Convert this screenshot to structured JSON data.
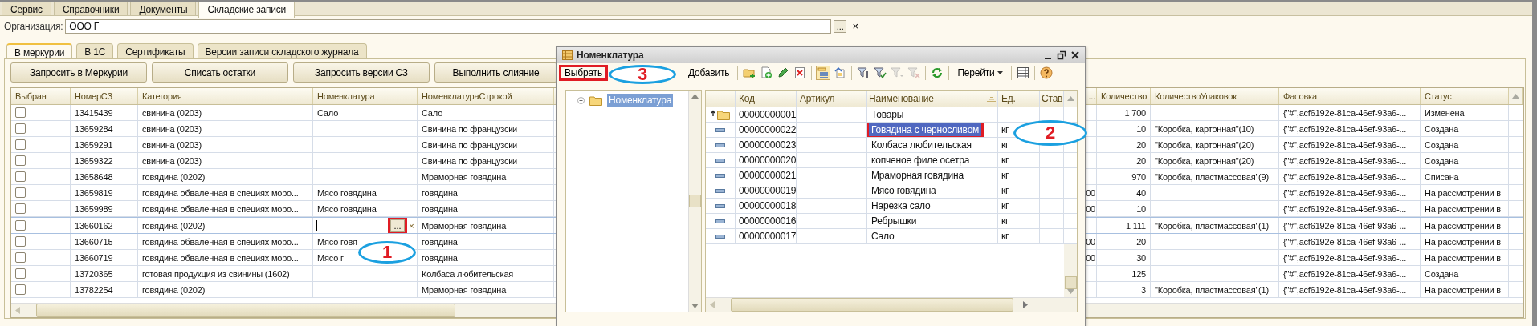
{
  "top_tabs": [
    {
      "label": "Сервис",
      "selected": false
    },
    {
      "label": "Справочники",
      "selected": false
    },
    {
      "label": "Документы",
      "selected": false
    },
    {
      "label": "Складские записи",
      "selected": true
    }
  ],
  "organization": {
    "label": "Организация:",
    "value": "ООО  Г",
    "select_button": "...",
    "clear_button": "×"
  },
  "inner_tabs": [
    {
      "label": "В меркурии",
      "selected": true
    },
    {
      "label": "В 1С",
      "selected": false
    },
    {
      "label": "Сертификаты",
      "selected": false
    },
    {
      "label": "Версии записи складского журнала",
      "selected": false
    }
  ],
  "actions": [
    "Запросить в Меркурии",
    "Списать остатки",
    "Запросить версии СЗ",
    "Выполнить слияние"
  ],
  "main_table": {
    "columns": [
      "Выбран",
      "НомерСЗ",
      "Категория",
      "Номенклатура",
      "НоменклатураСтрокой",
      "...",
      "Количество",
      "КоличествоУпаковок",
      "Фасовка",
      "Статус"
    ],
    "edit_controls": {
      "select": "...",
      "clear": "×",
      "highlighted": true
    },
    "rows": [
      {
        "checked": false,
        "editing": false,
        "number": "13415439",
        "category": "свинина (0203)",
        "nomenclature": "Сало",
        "nomenclature_string": "Сало",
        "column_6": "",
        "quantity": "1 700",
        "packages": "",
        "packaging": "{\"#\",acf6192e-81ca-46ef-93a6-...",
        "status": "Изменена"
      },
      {
        "checked": false,
        "editing": false,
        "number": "13659284",
        "category": "свинина (0203)",
        "nomenclature": "",
        "nomenclature_string": "Свинина по французски",
        "column_6": "",
        "quantity": "10",
        "packages": "\"Коробка, картонная\"(10)",
        "packaging": "{\"#\",acf6192e-81ca-46ef-93a6-...",
        "status": "Создана"
      },
      {
        "checked": false,
        "editing": false,
        "number": "13659291",
        "category": "свинина (0203)",
        "nomenclature": "",
        "nomenclature_string": "Свинина по французски",
        "column_6": "",
        "quantity": "20",
        "packages": "\"Коробка, картонная\"(20)",
        "packaging": "{\"#\",acf6192e-81ca-46ef-93a6-...",
        "status": "Создана"
      },
      {
        "checked": false,
        "editing": false,
        "number": "13659322",
        "category": "свинина (0203)",
        "nomenclature": "",
        "nomenclature_string": "Свинина по французски",
        "column_6": "",
        "quantity": "20",
        "packages": "\"Коробка, картонная\"(20)",
        "packaging": "{\"#\",acf6192e-81ca-46ef-93a6-...",
        "status": "Создана"
      },
      {
        "checked": false,
        "editing": false,
        "number": "13658648",
        "category": "говядина (0202)",
        "nomenclature": "",
        "nomenclature_string": "Мраморная говядина",
        "column_6": "",
        "quantity": "970",
        "packages": "\"Коробка, пластмассовая\"(9)",
        "packaging": "{\"#\",acf6192e-81ca-46ef-93a6-...",
        "status": "Списана"
      },
      {
        "checked": false,
        "editing": false,
        "number": "13659819",
        "category": "говядина обваленная в специях моро...",
        "nomenclature": "Мясо говядина",
        "nomenclature_string": "говядина",
        "column_6": "00",
        "quantity": "40",
        "packages": "",
        "packaging": "{\"#\",acf6192e-81ca-46ef-93a6-...",
        "status": "На рассмотрении в"
      },
      {
        "checked": false,
        "editing": false,
        "number": "13659989",
        "category": "говядина обваленная в специях моро...",
        "nomenclature": "Мясо говядина",
        "nomenclature_string": "говядина",
        "column_6": "00",
        "quantity": "10",
        "packages": "",
        "packaging": "{\"#\",acf6192e-81ca-46ef-93a6-...",
        "status": "На рассмотрении в"
      },
      {
        "checked": false,
        "editing": true,
        "number": "13660162",
        "category": "говядина (0202)",
        "nomenclature": "",
        "nomenclature_string": "Мраморная говядина",
        "column_6": "",
        "quantity": "1 111",
        "packages": "\"Коробка, пластмассовая\"(1)",
        "packaging": "{\"#\",acf6192e-81ca-46ef-93a6-...",
        "status": "На рассмотрении в"
      },
      {
        "checked": false,
        "editing": false,
        "number": "13660715",
        "category": "говядина обваленная в специях моро...",
        "nomenclature": "Мясо говя",
        "nomenclature_string": "говядина",
        "column_6": "00",
        "quantity": "20",
        "packages": "",
        "packaging": "{\"#\",acf6192e-81ca-46ef-93a6-...",
        "status": "На рассмотрении в"
      },
      {
        "checked": false,
        "editing": false,
        "number": "13660719",
        "category": "говядина обваленная в специях моро...",
        "nomenclature": "Мясо г",
        "nomenclature_string": "говядина",
        "column_6": "00",
        "quantity": "30",
        "packages": "",
        "packaging": "{\"#\",acf6192e-81ca-46ef-93a6-...",
        "status": "На рассмотрении в"
      },
      {
        "checked": false,
        "editing": false,
        "number": "13720365",
        "category": "готовая продукция из свинины (1602)",
        "nomenclature": "",
        "nomenclature_string": "Колбаса любительская",
        "column_6": "",
        "quantity": "125",
        "packages": "",
        "packaging": "{\"#\",acf6192e-81ca-46ef-93a6-...",
        "status": "Создана"
      },
      {
        "checked": false,
        "editing": false,
        "number": "13782254",
        "category": "говядина (0202)",
        "nomenclature": "",
        "nomenclature_string": "Мраморная говядина",
        "column_6": "",
        "quantity": "3",
        "packages": "\"Коробка, пластмассовая\"(1)",
        "packaging": "{\"#\",acf6192e-81ca-46ef-93a6-...",
        "status": "На рассмотрении в"
      }
    ]
  },
  "dialog": {
    "title": "Номенклатура",
    "toolbar": [
      {
        "kind": "button",
        "label": "Выбрать",
        "highlighted": true
      },
      {
        "kind": "button",
        "label": "Добавить",
        "highlighted": false
      },
      {
        "kind": "separator"
      },
      {
        "kind": "icon",
        "pressed": false,
        "disabled": false
      },
      {
        "kind": "icon",
        "pressed": false,
        "disabled": false
      },
      {
        "kind": "icon",
        "pressed": false,
        "disabled": false
      },
      {
        "kind": "icon",
        "pressed": false,
        "disabled": false
      },
      {
        "kind": "separator"
      },
      {
        "kind": "icon",
        "pressed": true,
        "disabled": false
      },
      {
        "kind": "icon",
        "pressed": false,
        "disabled": false
      },
      {
        "kind": "separator"
      },
      {
        "kind": "icon",
        "pressed": false,
        "disabled": false
      },
      {
        "kind": "icon",
        "pressed": false,
        "disabled": false
      },
      {
        "kind": "icon",
        "pressed": false,
        "disabled": true
      },
      {
        "kind": "icon",
        "pressed": false,
        "disabled": true
      },
      {
        "kind": "separator"
      },
      {
        "kind": "icon",
        "pressed": false,
        "disabled": false
      },
      {
        "kind": "separator"
      },
      {
        "kind": "menu",
        "label": "Перейти"
      },
      {
        "kind": "separator"
      },
      {
        "kind": "icon",
        "pressed": false,
        "disabled": false
      },
      {
        "kind": "separator"
      },
      {
        "kind": "icon",
        "pressed": false,
        "disabled": false
      }
    ],
    "tree": [
      {
        "label": "Номенклатура",
        "selected": true,
        "expanded": false
      }
    ],
    "columns": [
      "Код",
      "Артикул",
      "Наименование",
      "Ед.",
      "Став"
    ],
    "rows": [
      {
        "kind": "parent",
        "code": "00000000001",
        "article": "",
        "name": "Товары",
        "unit": "",
        "selected": false
      },
      {
        "kind": "item",
        "code": "00000000022",
        "article": "",
        "name": "Говядина с черносливом",
        "unit": "кг",
        "selected": true
      },
      {
        "kind": "item",
        "code": "00000000023",
        "article": "",
        "name": "Колбаса любительская",
        "unit": "кг",
        "selected": false
      },
      {
        "kind": "item",
        "code": "00000000020",
        "article": "",
        "name": "копченое филе осетра",
        "unit": "кг",
        "selected": false
      },
      {
        "kind": "item",
        "code": "00000000021",
        "article": "",
        "name": "Мраморная говядина",
        "unit": "кг",
        "selected": false
      },
      {
        "kind": "item",
        "code": "00000000019",
        "article": "",
        "name": "Мясо говядина",
        "unit": "кг",
        "selected": false
      },
      {
        "kind": "item",
        "code": "00000000018",
        "article": "",
        "name": "Нарезка сало",
        "unit": "кг",
        "selected": false
      },
      {
        "kind": "item",
        "code": "00000000016",
        "article": "",
        "name": "Ребрышки",
        "unit": "кг",
        "selected": false
      },
      {
        "kind": "item",
        "code": "00000000017",
        "article": "",
        "name": "Сало",
        "unit": "кг",
        "selected": false
      }
    ]
  },
  "annotations": [
    {
      "label": "1"
    },
    {
      "label": "2"
    },
    {
      "label": "3"
    }
  ]
}
